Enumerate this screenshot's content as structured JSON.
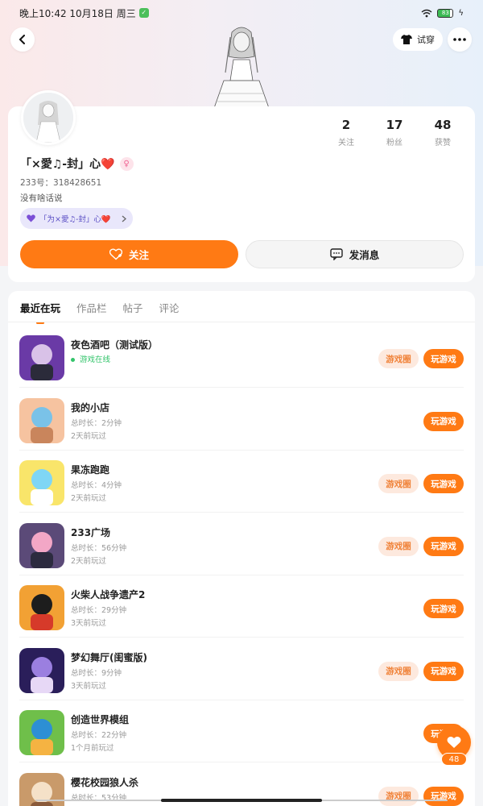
{
  "status_bar": {
    "time": "晚上10:42 10月18日 周三",
    "battery": "83"
  },
  "top_nav": {
    "try_on_label": "试穿"
  },
  "profile": {
    "name": "「×愛♫-封」心❤️",
    "uid": "233号：318428651",
    "bio": "没有啥话说",
    "tag": "「为×愛♫-封」心❤️",
    "stats": [
      {
        "value": "2",
        "label": "关注"
      },
      {
        "value": "17",
        "label": "粉丝"
      },
      {
        "value": "48",
        "label": "获赞"
      }
    ],
    "follow_label": "关注",
    "message_label": "发消息"
  },
  "tabs": [
    {
      "label": "最近在玩",
      "active": true
    },
    {
      "label": "作品栏",
      "active": false
    },
    {
      "label": "帖子",
      "active": false
    },
    {
      "label": "评论",
      "active": false
    }
  ],
  "games": [
    {
      "name": "夜色酒吧（测试版）",
      "line1": "游戏在线",
      "line2": "",
      "online": true,
      "circle": true
    },
    {
      "name": "我的小店",
      "line1": "总时长：2分钟",
      "line2": "2天前玩过",
      "online": false,
      "circle": false
    },
    {
      "name": "果冻跑跑",
      "line1": "总时长：4分钟",
      "line2": "2天前玩过",
      "online": false,
      "circle": true
    },
    {
      "name": "233广场",
      "line1": "总时长：56分钟",
      "line2": "2天前玩过",
      "online": false,
      "circle": true
    },
    {
      "name": "火柴人战争遗产2",
      "line1": "总时长：29分钟",
      "line2": "3天前玩过",
      "online": false,
      "circle": false
    },
    {
      "name": "梦幻舞厅(闺蜜版)",
      "line1": "总时长：9分钟",
      "line2": "3天前玩过",
      "online": false,
      "circle": true
    },
    {
      "name": "创造世界模组",
      "line1": "总时长：22分钟",
      "line2": "1个月前玩过",
      "online": false,
      "circle": false
    },
    {
      "name": "樱花校园狼人杀",
      "line1": "总时长：53分钟",
      "line2": "",
      "online": false,
      "circle": true
    }
  ],
  "buttons": {
    "circle_label": "游戏圈",
    "play_label": "玩游戏"
  },
  "likes": {
    "count": "48"
  },
  "colors": {
    "accent": "#ff7a14",
    "online": "#33c46b",
    "tag_bg": "#e9e7fb"
  },
  "icons": [
    "back-arrow-icon",
    "shirt-icon",
    "more-dots-icon",
    "add-friend-icon",
    "chat-bubble-icon",
    "heart-icon",
    "chevron-right-icon",
    "gender-female-icon"
  ]
}
